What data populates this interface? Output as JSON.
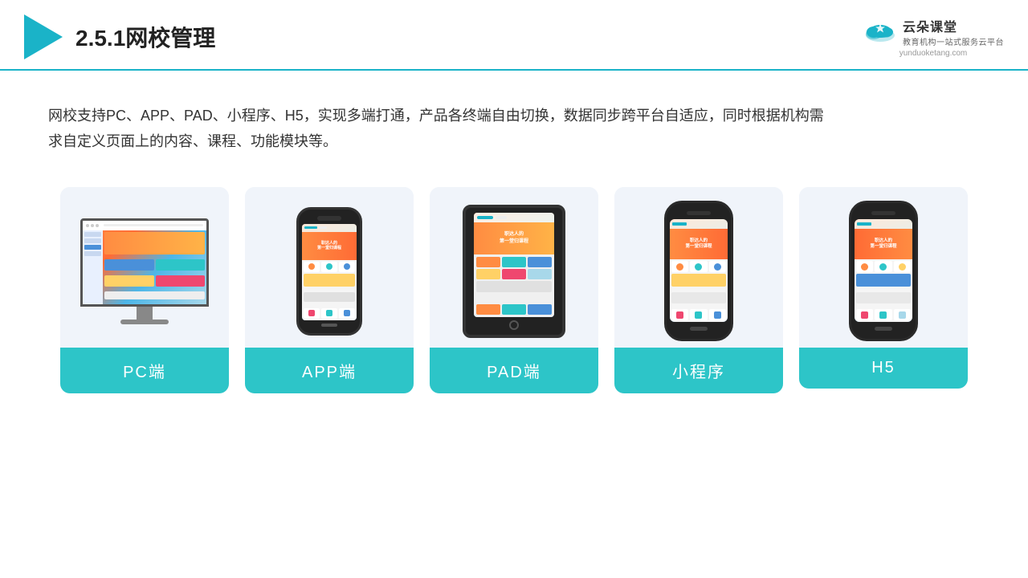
{
  "header": {
    "title": "2.5.1网校管理",
    "brand": {
      "name": "云朵课堂",
      "tagline": "教育机构一站式服务云平台",
      "url": "yunduoketang.com"
    }
  },
  "description": {
    "text": "网校支持PC、APP、PAD、小程序、H5，实现多端打通，产品各终端自由切换，数据同步跨平台自适应，同时根据机构需求自定义页面上的内容、课程、功能模块等。"
  },
  "cards": [
    {
      "id": "pc",
      "label": "PC端"
    },
    {
      "id": "app",
      "label": "APP端"
    },
    {
      "id": "pad",
      "label": "PAD端"
    },
    {
      "id": "miniprogram",
      "label": "小程序"
    },
    {
      "id": "h5",
      "label": "H5"
    }
  ]
}
